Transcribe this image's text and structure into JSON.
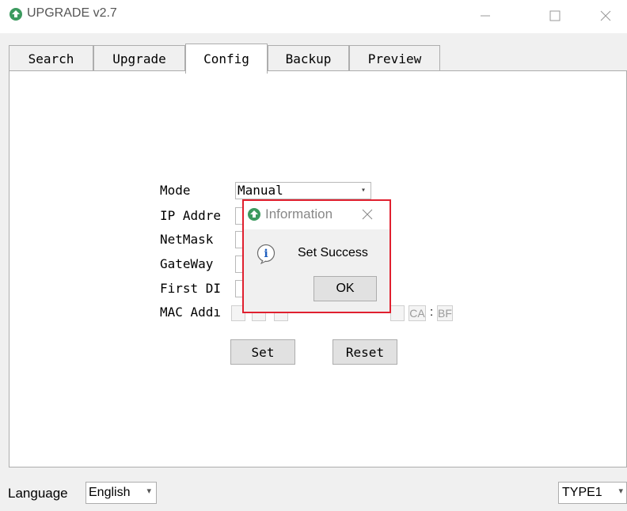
{
  "window": {
    "title": "UPGRADE v2.7",
    "icons": {
      "app": "app-upload-icon",
      "minimize": "minimize-icon",
      "maximize": "maximize-icon",
      "close": "close-icon"
    }
  },
  "tabs": [
    {
      "label": "Search",
      "active": false
    },
    {
      "label": "Upgrade",
      "active": false
    },
    {
      "label": "Config",
      "active": true
    },
    {
      "label": "Backup",
      "active": false
    },
    {
      "label": "Preview",
      "active": false
    }
  ],
  "config": {
    "mode_label": "Mode",
    "mode_value": "Manual",
    "ip_label": "IP Addre",
    "netmask_label": "NetMask",
    "gateway_label": "GateWay",
    "dns_label": "First DI",
    "mac_label": "MAC Addı",
    "mac_visible_segments": [
      "CA",
      "BF"
    ],
    "mac_separator": ":",
    "set_button": "Set",
    "reset_button": "Reset"
  },
  "dialog": {
    "title": "Information",
    "message": "Set Success",
    "ok_button": "OK",
    "icons": {
      "title": "app-upload-icon",
      "close": "close-icon",
      "message": "info-icon"
    }
  },
  "bottom": {
    "language_label": "Language",
    "language_value": "English",
    "type_value": "TYPE1"
  },
  "colors": {
    "accent_green": "#3c9a5f",
    "highlight_red": "#e0202f",
    "info_blue": "#1f5fbf"
  }
}
